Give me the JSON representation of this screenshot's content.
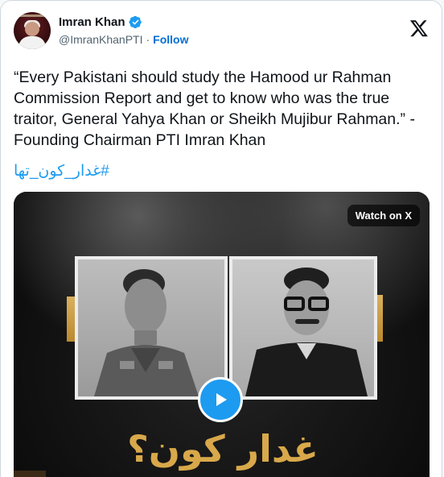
{
  "author": {
    "name": "Imran Khan",
    "handle": "@ImranKhanPTI",
    "separator": "·",
    "follow_label": "Follow"
  },
  "tweet": {
    "text": "“Every Pakistani should study the Hamood ur Rahman Commission Report and get to know who was the true traitor, General Yahya Khan or Sheikh Mujibur Rahman.” - Founding Chairman PTI Imran Khan",
    "hashtag": "#غدار_کون_تھا"
  },
  "media": {
    "watch_label": "Watch on X",
    "overlay_title": "غدار کون؟"
  },
  "colors": {
    "accent": "#1d9bf0",
    "follow": "#006fd6",
    "text": "#0f1419",
    "muted": "#536471",
    "gold": "#d8a84a"
  },
  "icons": {
    "verified": "verified-badge-icon",
    "brand": "x-logo-icon",
    "play": "play-icon"
  }
}
